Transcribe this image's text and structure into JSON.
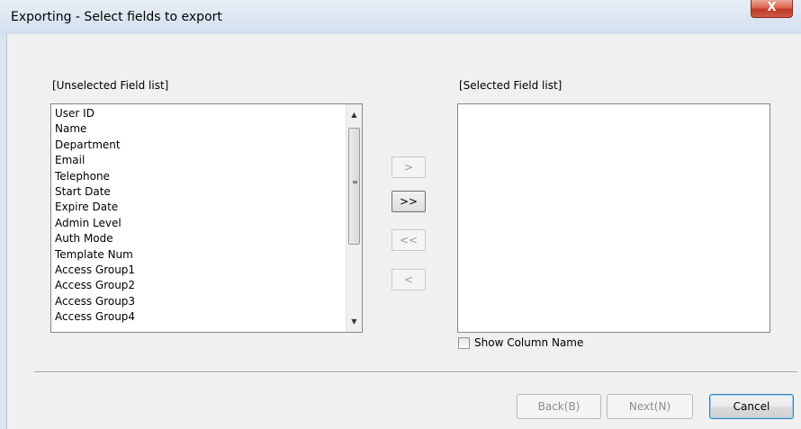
{
  "window": {
    "title": "Exporting - Select fields to export",
    "close_label": "X"
  },
  "unselected": {
    "label": "[Unselected Field list]",
    "items": [
      "User ID",
      "Name",
      "Department",
      "Email",
      "Telephone",
      "Start Date",
      "Expire Date",
      "Admin Level",
      "Auth Mode",
      "Template Num",
      "Access Group1",
      "Access Group2",
      "Access Group3",
      "Access Group4"
    ]
  },
  "selected": {
    "label": "[Selected Field list]",
    "items": []
  },
  "move_buttons": {
    "add_one": ">",
    "add_all": ">>",
    "remove_all": "<<",
    "remove_one": "<"
  },
  "options": {
    "show_column_name": "Show Column Name",
    "show_column_name_checked": false
  },
  "footer": {
    "back": "Back(B)",
    "next": "Next(N)",
    "cancel": "Cancel"
  }
}
